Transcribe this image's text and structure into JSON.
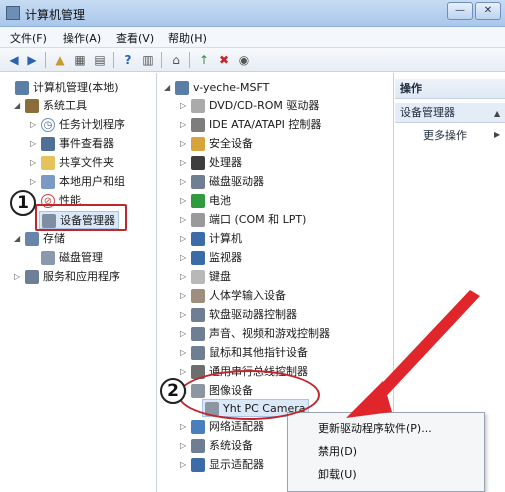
{
  "window": {
    "title": "计算机管理"
  },
  "menu": [
    "文件(F)",
    "操作(A)",
    "查看(V)",
    "帮助(H)"
  ],
  "left_tree": [
    {
      "label": "计算机管理(本地)",
      "icon": "computer-management-icon",
      "indent": 0,
      "expander": ""
    },
    {
      "label": "系统工具",
      "icon": "system-tools-icon",
      "indent": 1,
      "expander": "◢"
    },
    {
      "label": "任务计划程序",
      "icon": "task-scheduler-icon",
      "indent": 2,
      "expander": "▷"
    },
    {
      "label": "事件查看器",
      "icon": "event-viewer-icon",
      "indent": 2,
      "expander": "▷"
    },
    {
      "label": "共享文件夹",
      "icon": "shared-folder-icon",
      "indent": 2,
      "expander": "▷"
    },
    {
      "label": "本地用户和组",
      "icon": "local-users-icon",
      "indent": 2,
      "expander": "▷"
    },
    {
      "label": "性能",
      "icon": "performance-icon",
      "indent": 2,
      "expander": "▷"
    },
    {
      "label": "设备管理器",
      "icon": "device-manager-icon",
      "indent": 2,
      "expander": ""
    },
    {
      "label": "存储",
      "icon": "storage-icon",
      "indent": 1,
      "expander": "◢"
    },
    {
      "label": "磁盘管理",
      "icon": "disk-management-icon",
      "indent": 2,
      "expander": ""
    },
    {
      "label": "服务和应用程序",
      "icon": "services-apps-icon",
      "indent": 1,
      "expander": "▷"
    }
  ],
  "device_tree": {
    "root": "v-yeche-MSFT",
    "items": [
      {
        "label": "DVD/CD-ROM 驱动器",
        "icon": "dvd-icon"
      },
      {
        "label": "IDE ATA/ATAPI 控制器",
        "icon": "ide-controller-icon"
      },
      {
        "label": "安全设备",
        "icon": "security-device-icon"
      },
      {
        "label": "处理器",
        "icon": "processor-icon"
      },
      {
        "label": "磁盘驱动器",
        "icon": "disk-drive-icon"
      },
      {
        "label": "电池",
        "icon": "battery-icon"
      },
      {
        "label": "端口 (COM 和 LPT)",
        "icon": "port-icon"
      },
      {
        "label": "计算机",
        "icon": "computer-icon"
      },
      {
        "label": "监视器",
        "icon": "monitor-icon"
      },
      {
        "label": "键盘",
        "icon": "keyboard-icon"
      },
      {
        "label": "人体学输入设备",
        "icon": "hid-icon"
      },
      {
        "label": "软盘驱动器控制器",
        "icon": "floppy-controller-icon"
      },
      {
        "label": "声音、视频和游戏控制器",
        "icon": "sound-icon"
      },
      {
        "label": "鼠标和其他指针设备",
        "icon": "mouse-icon"
      },
      {
        "label": "通用串行总线控制器",
        "icon": "usb-icon"
      },
      {
        "label": "图像设备",
        "icon": "imaging-device-icon"
      },
      {
        "label": "Yht PC Camera",
        "icon": "camera-icon"
      },
      {
        "label": "网络适配器",
        "icon": "network-adapter-icon"
      },
      {
        "label": "系统设备",
        "icon": "system-device-icon"
      },
      {
        "label": "显示适配器",
        "icon": "display-adapter-icon"
      }
    ]
  },
  "actions": {
    "header": "操作",
    "section": "设备管理器",
    "more": "更多操作"
  },
  "context_menu": [
    "更新驱动程序软件(P)...",
    "禁用(D)",
    "卸载(U)"
  ],
  "annotations": {
    "step1": "1",
    "step2": "2"
  },
  "colors": {
    "annotation_red": "#c0272d",
    "arrow_red": "#e0262b",
    "title_bar": "#b9d1ee"
  }
}
